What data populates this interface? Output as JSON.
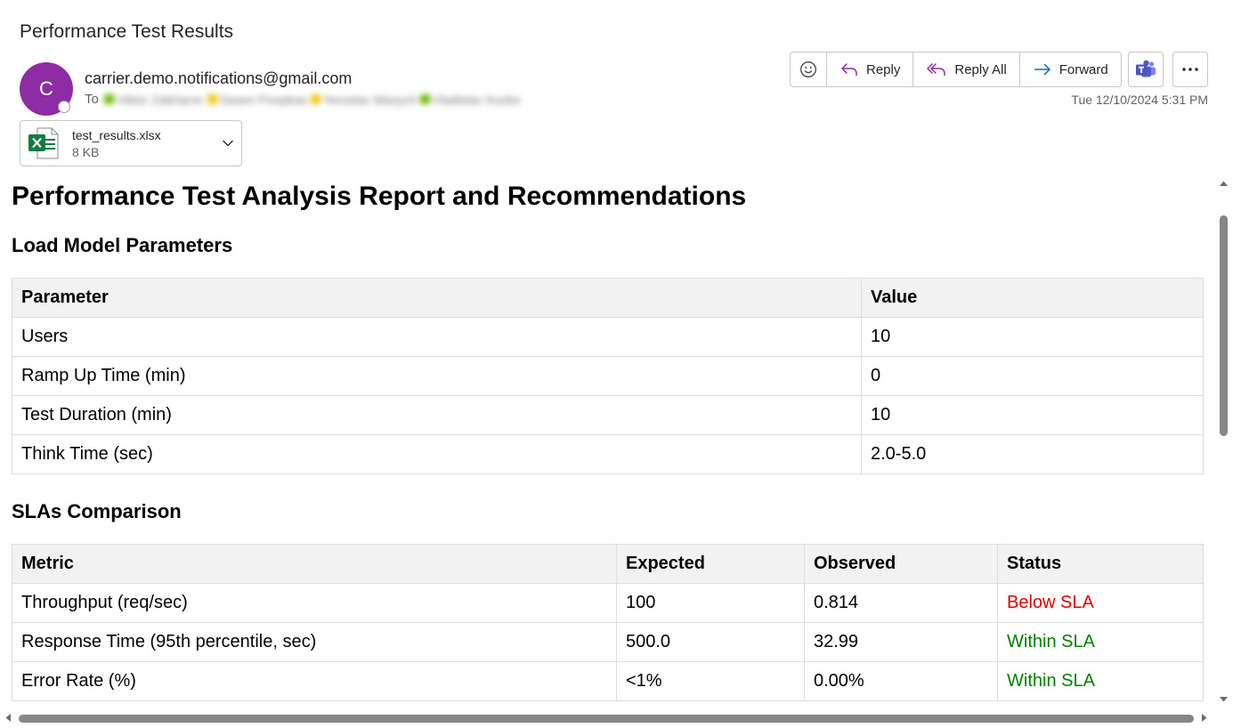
{
  "email": {
    "subject": "Performance Test Results",
    "avatar_initial": "C",
    "sender": "carrier.demo.notifications@gmail.com",
    "to_label": "To",
    "recipients": [
      "Viktor Zakharov",
      "Sasen Poopkas",
      "Yeroslav Mazych",
      "Vladislav Kozko"
    ],
    "date": "Tue 12/10/2024 5:31 PM"
  },
  "toolbar": {
    "reply_label": "Reply",
    "reply_all_label": "Reply All",
    "forward_label": "Forward"
  },
  "attachment": {
    "name": "test_results.xlsx",
    "size": "8 KB"
  },
  "report": {
    "title": "Performance Test Analysis Report and Recommendations",
    "load_model": {
      "heading": "Load Model Parameters",
      "headers": [
        "Parameter",
        "Value"
      ],
      "rows": [
        [
          "Users",
          "10"
        ],
        [
          "Ramp Up Time (min)",
          "0"
        ],
        [
          "Test Duration (min)",
          "10"
        ],
        [
          "Think Time (sec)",
          "2.0-5.0"
        ]
      ]
    },
    "slas": {
      "heading": "SLAs Comparison",
      "headers": [
        "Metric",
        "Expected",
        "Observed",
        "Status"
      ],
      "rows": [
        [
          "Throughput (req/sec)",
          "100",
          "0.814",
          "Below SLA"
        ],
        [
          "Response Time (95th percentile, sec)",
          "500.0",
          "32.99",
          "Within SLA"
        ],
        [
          "Error Rate (%)",
          "<1%",
          "0.00%",
          "Within SLA"
        ]
      ]
    }
  },
  "colors": {
    "avatar": "#8e2da3",
    "accent_reply": "#8e2da3",
    "accent_forward": "#0f6cbd",
    "status_bad": "#e00000",
    "status_good": "#008000",
    "excel_green": "#107c41"
  }
}
